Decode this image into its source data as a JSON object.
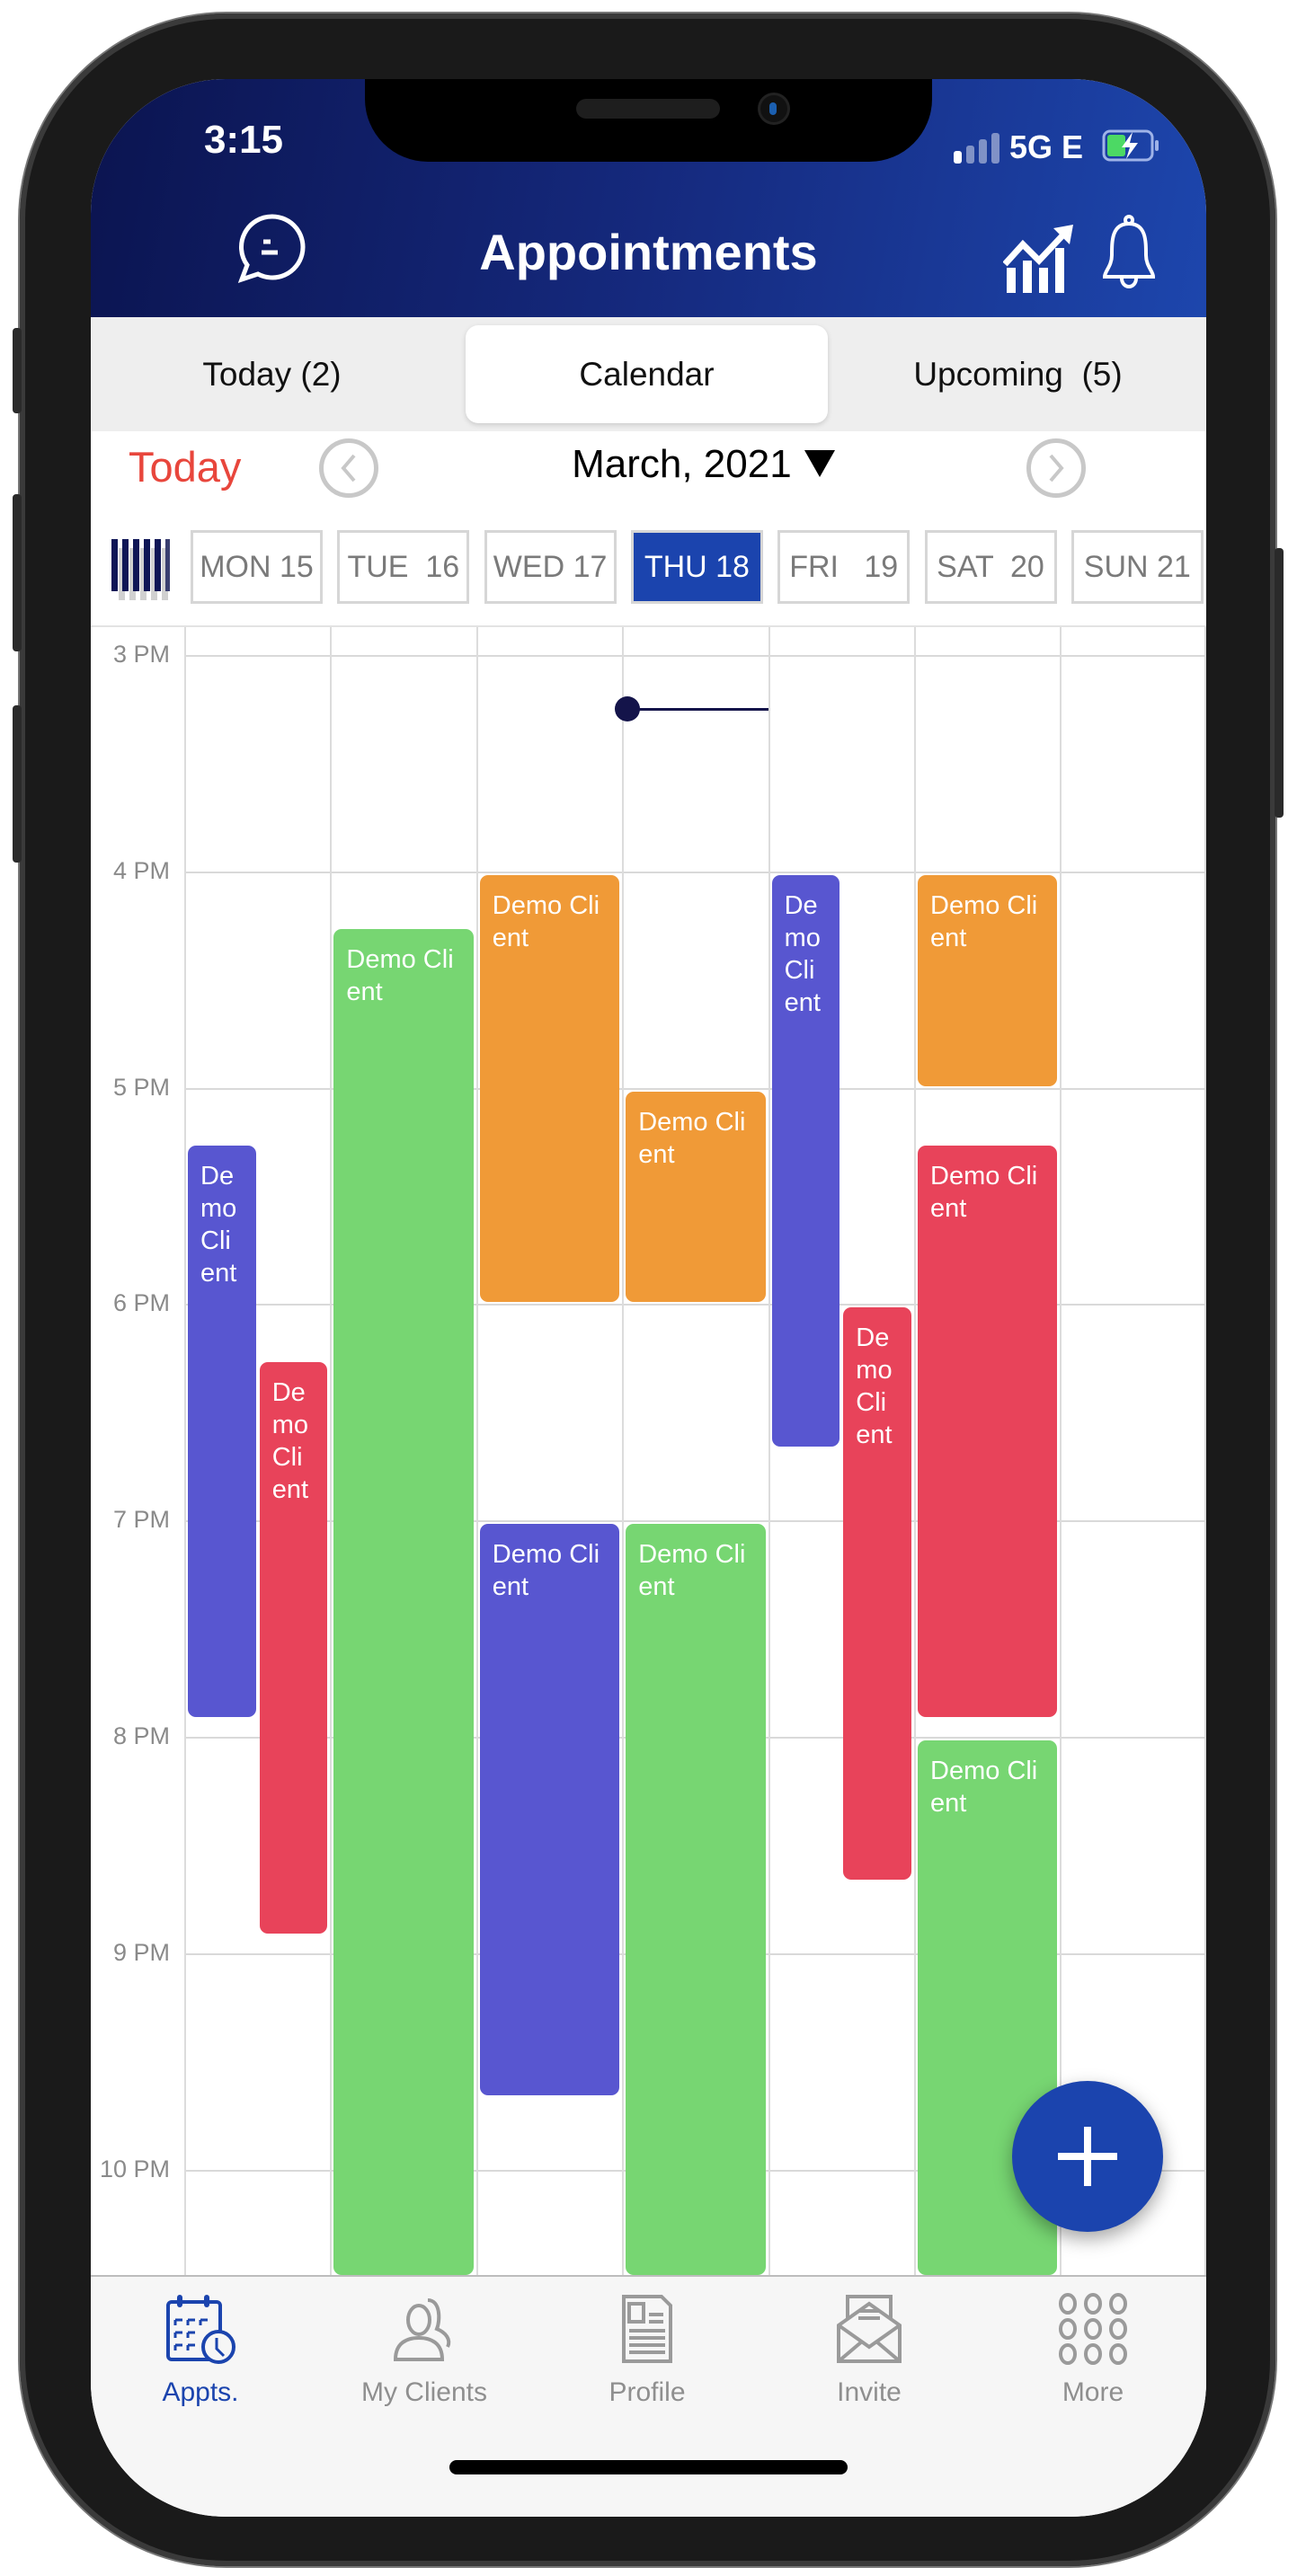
{
  "status_bar": {
    "time": "3:15",
    "network": "5G E",
    "battery_icon": "battery-charging-icon",
    "signal_icon": "signal-bars-icon"
  },
  "header": {
    "title": "Appointments",
    "left_icon": "chat-bubble-icon",
    "right_icons": [
      "growth-chart-icon",
      "bell-icon"
    ]
  },
  "tabs": [
    {
      "label": "Today (2)",
      "selected": false
    },
    {
      "label": "Calendar",
      "selected": true
    },
    {
      "label": "Upcoming  (5)",
      "selected": false
    }
  ],
  "date_nav": {
    "today_label": "Today",
    "month_label": "March, 2021",
    "dropdown_icon": "triangle-down-icon",
    "prev_icon": "chevron-left-circle-icon",
    "next_icon": "chevron-right-circle-icon"
  },
  "week_view_icon": "week-grid-icon",
  "days": [
    {
      "label": "MON 15",
      "selected": false
    },
    {
      "label": "TUE  16",
      "selected": false
    },
    {
      "label": "WED 17",
      "selected": false
    },
    {
      "label": "THU 18",
      "selected": true
    },
    {
      "label": "FRI   19",
      "selected": false
    },
    {
      "label": "SAT  20",
      "selected": false
    },
    {
      "label": "SUN 21",
      "selected": false
    }
  ],
  "hours": [
    "3 PM",
    "4 PM",
    "5 PM",
    "6 PM",
    "7 PM",
    "8 PM",
    "9 PM",
    "10 PM"
  ],
  "current_time": {
    "day": 3,
    "time": "15:15"
  },
  "colors": {
    "accent": "#1b44ae",
    "today": "#e8463c",
    "blue": "#5856d0",
    "red": "#e8435a",
    "green": "#77d672",
    "orange": "#f09a37",
    "now_line": "#14144a"
  },
  "events": [
    {
      "day": 0,
      "title": "Demo Client",
      "start": "17:15",
      "end": "19:55",
      "color": "#5856d0"
    },
    {
      "day": 0,
      "title": "Demo Client",
      "start": "18:15",
      "end": "20:55",
      "color": "#e8435a"
    },
    {
      "day": 1,
      "title": "Demo Client",
      "start": "16:15",
      "end": null,
      "color": "#77d672"
    },
    {
      "day": 2,
      "title": "Demo Client",
      "start": "16:00",
      "end": "18:00",
      "color": "#f09a37"
    },
    {
      "day": 2,
      "title": "Demo Client",
      "start": "19:00",
      "end": "21:40",
      "color": "#5856d0"
    },
    {
      "day": 3,
      "title": "Demo Client",
      "start": "17:00",
      "end": "18:00",
      "color": "#f09a37"
    },
    {
      "day": 3,
      "title": "Demo Client",
      "start": "19:00",
      "end": null,
      "color": "#77d672"
    },
    {
      "day": 4,
      "title": "Demo Client",
      "start": "16:00",
      "end": "18:40",
      "color": "#5856d0"
    },
    {
      "day": 4,
      "title": "Demo Client",
      "start": "18:00",
      "end": "20:40",
      "color": "#e8435a"
    },
    {
      "day": 5,
      "title": "Demo Client",
      "start": "16:00",
      "end": "17:00",
      "color": "#f09a37"
    },
    {
      "day": 5,
      "title": "Demo Client",
      "start": "17:15",
      "end": "19:55",
      "color": "#e8435a"
    },
    {
      "day": 5,
      "title": "Demo Client",
      "start": "20:00",
      "end": null,
      "color": "#77d672"
    }
  ],
  "fab": {
    "icon": "plus-icon"
  },
  "tabbar": [
    {
      "label": "Appts.",
      "icon": "calendar-clock-icon",
      "selected": true
    },
    {
      "label": "My Clients",
      "icon": "users-icon",
      "selected": false
    },
    {
      "label": "Profile",
      "icon": "profile-document-icon",
      "selected": false
    },
    {
      "label": "Invite",
      "icon": "envelope-icon",
      "selected": false
    },
    {
      "label": "More",
      "icon": "grid-dots-icon",
      "selected": false
    }
  ]
}
